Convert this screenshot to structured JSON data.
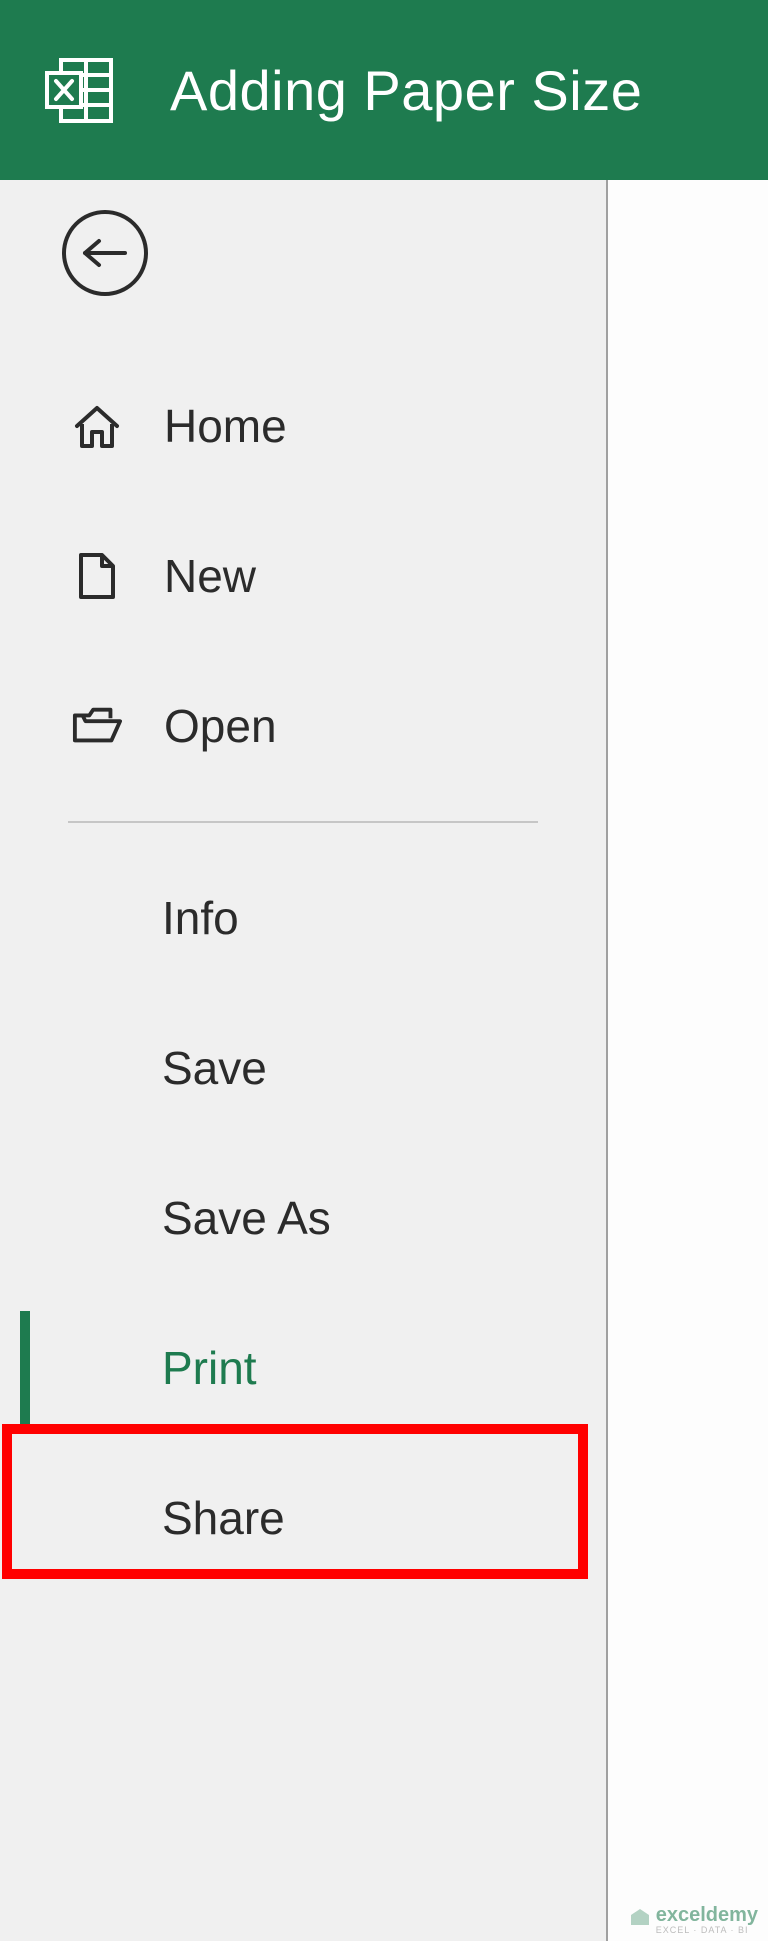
{
  "titlebar": {
    "title": "Adding Paper Size"
  },
  "nav": {
    "home": "Home",
    "new": "New",
    "open": "Open",
    "info": "Info",
    "save": "Save",
    "save_as": "Save As",
    "print": "Print",
    "share": "Share"
  },
  "watermark": {
    "text": "exceldemy",
    "sub": "EXCEL · DATA · BI"
  }
}
